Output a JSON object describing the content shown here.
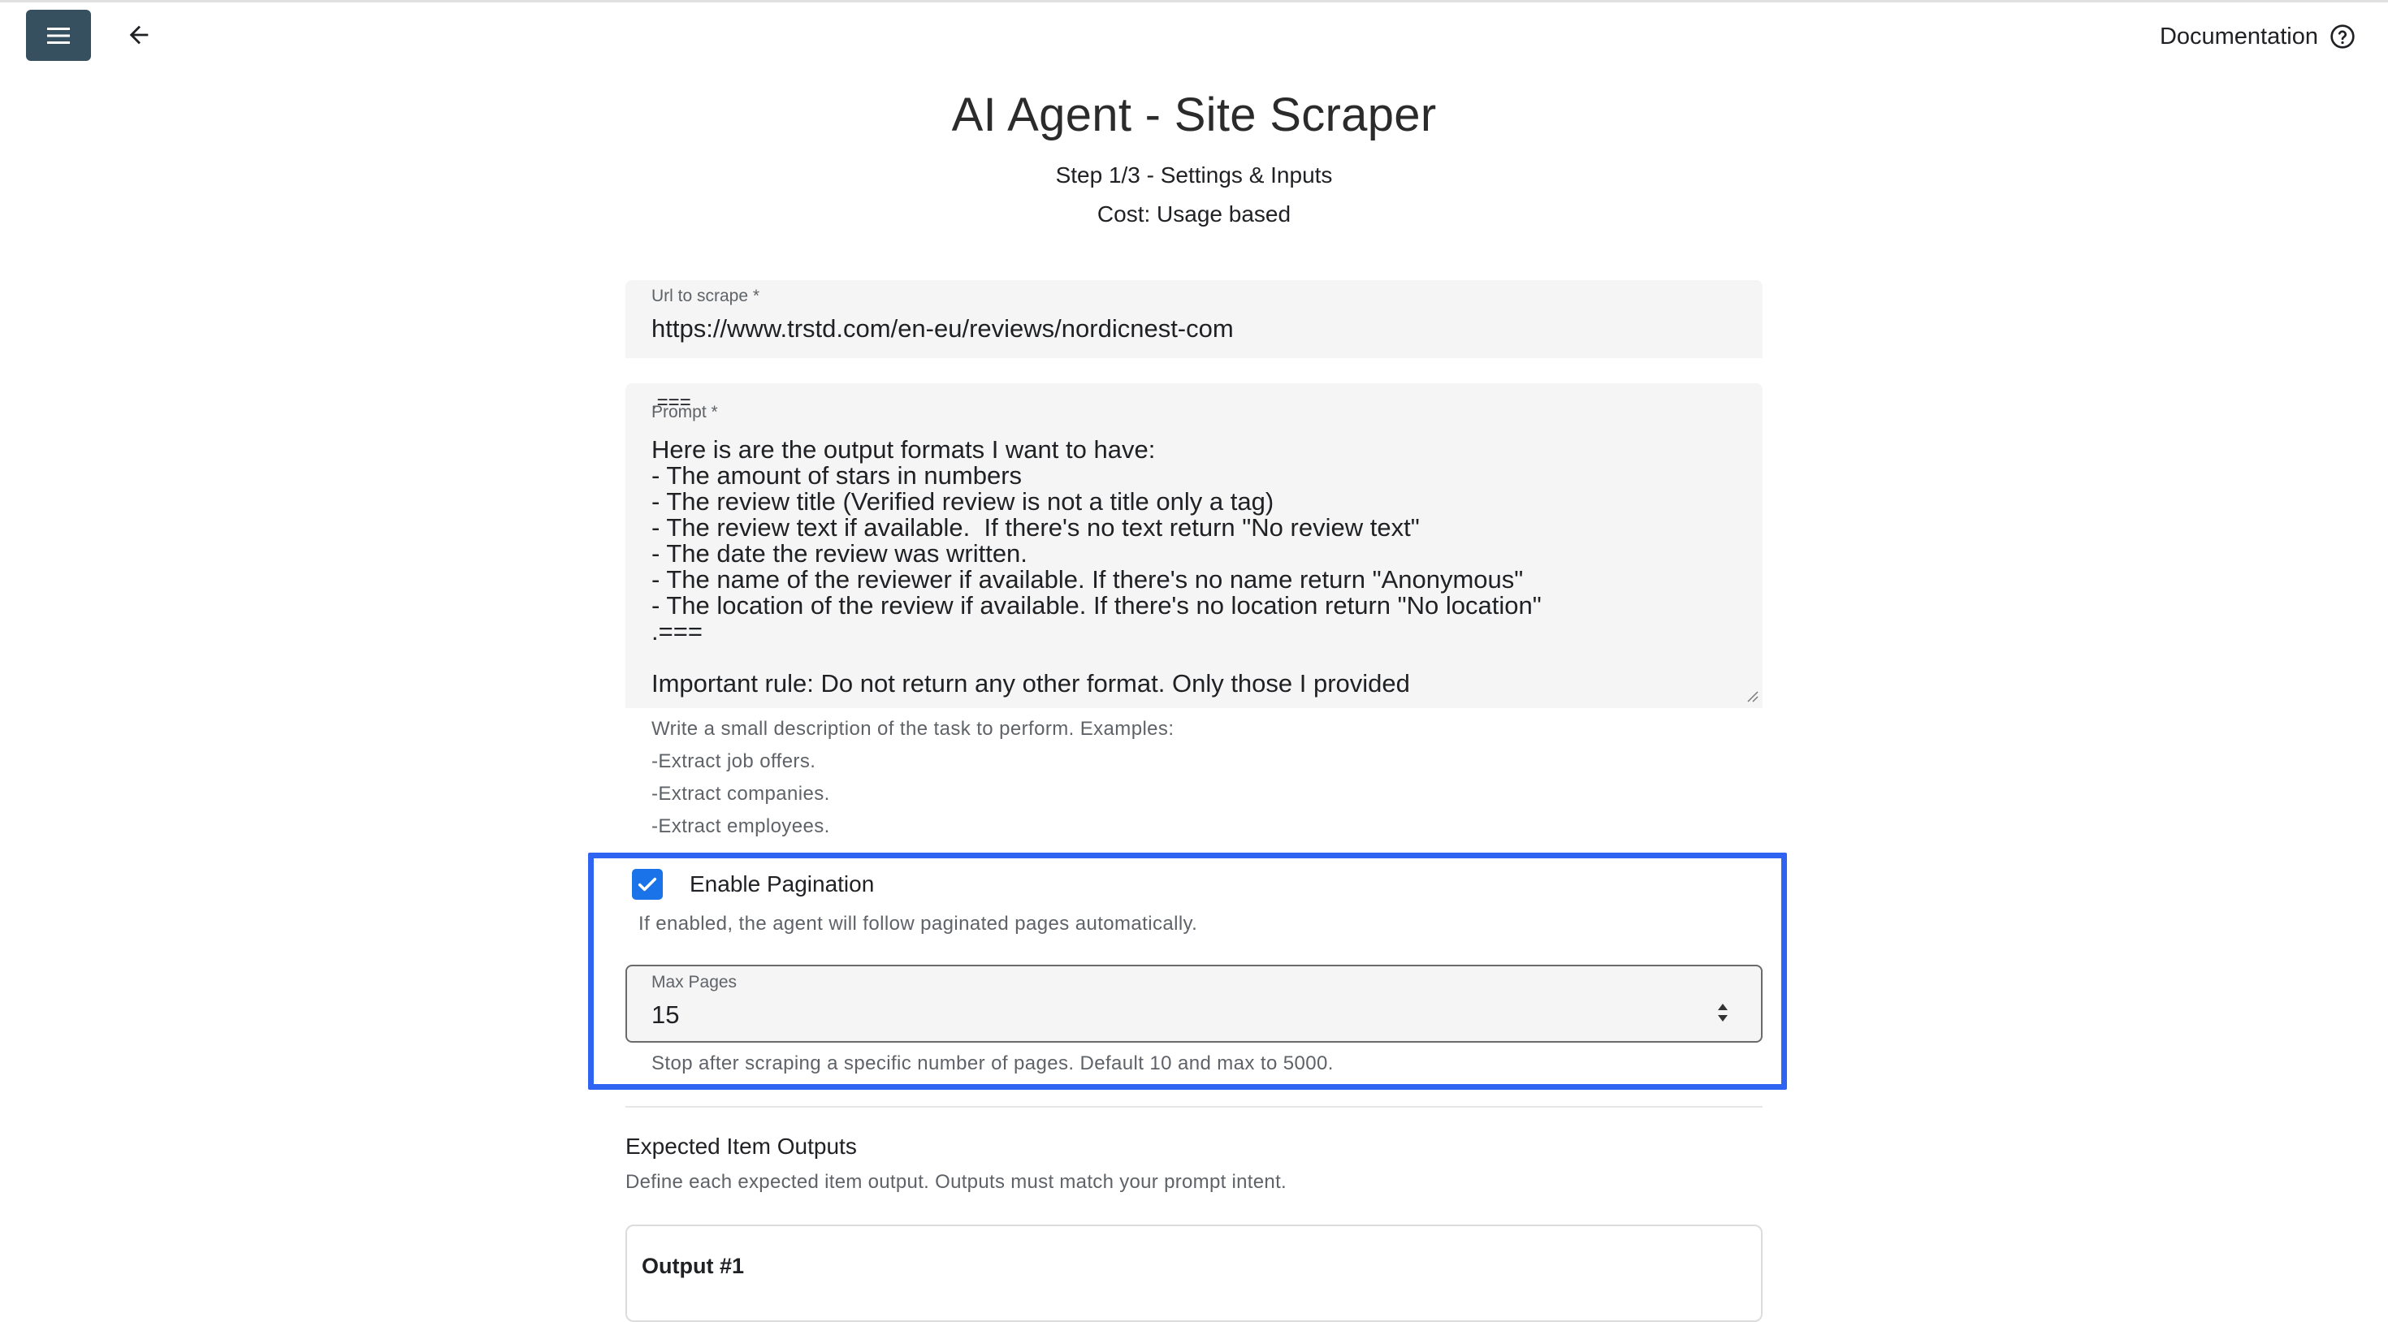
{
  "header": {
    "menu_icon": "hamburger-menu-icon",
    "back_icon": "arrow-left-icon",
    "docs_label": "Documentation",
    "docs_icon": "help-circle-icon"
  },
  "page": {
    "title": "AI Agent - Site Scraper",
    "step": "Step 1/3 - Settings & Inputs",
    "cost": "Cost: Usage based"
  },
  "url_field": {
    "label": "Url to scrape *",
    "value": "https://www.trstd.com/en-eu/reviews/nordicnest-com"
  },
  "prompt_field": {
    "label": "Prompt *",
    "overflow_line": ".===",
    "value": "Here is are the output formats I want to have:\n- The amount of stars in numbers\n- The review title (Verified review is not a title only a tag)\n- The review text if available.  If there's no text return \"No review text\"\n- The date the review was written.\n- The name of the reviewer if available. If there's no name return \"Anonymous\"\n- The location of the review if available. If there's no location return \"No location\"\n.===\n\nImportant rule: Do not return any other format. Only those I provided",
    "hints": [
      "Write a small description of the task to perform. Examples:",
      "-Extract job offers.",
      "-Extract companies.",
      "-Extract employees."
    ]
  },
  "pagination": {
    "checkbox_label": "Enable Pagination",
    "checked": true,
    "description": "If enabled, the agent will follow paginated pages automatically.",
    "max_pages_label": "Max Pages",
    "max_pages_value": "15",
    "max_pages_hint": "Stop after scraping a specific number of pages. Default 10 and max to 5000.",
    "highlight_color": "#2f63f2"
  },
  "outputs": {
    "title": "Expected Item Outputs",
    "description": "Define each expected item output. Outputs must match your prompt intent.",
    "first_card_title": "Output #1"
  },
  "colors": {
    "menu_button_bg": "#37505f",
    "checkbox_blue": "#1a73e8",
    "field_bg": "#f4f5f4"
  }
}
